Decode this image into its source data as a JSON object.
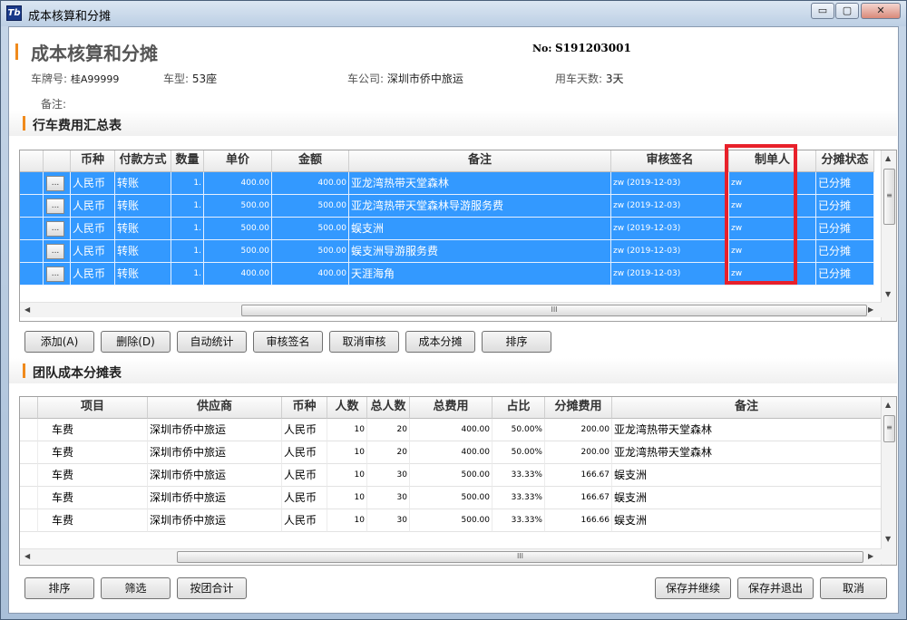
{
  "window": {
    "title": "成本核算和分摊",
    "icon_text": "Tb",
    "controls": {
      "minimize": "▭",
      "restore": "▢",
      "close": "✕"
    }
  },
  "header": {
    "title": "成本核算和分摊",
    "no_label": "No:",
    "no_value": "S191203001"
  },
  "info": {
    "plate_label": "车牌号:",
    "plate_value": "桂A99999",
    "model_label": "车型:",
    "model_value": "53座",
    "company_label": "车公司:",
    "company_value": "深圳市侨中旅运",
    "days_label": "用车天数:",
    "days_value": "3天",
    "remark_label": "备注:"
  },
  "section1": {
    "title": "行车费用汇总表"
  },
  "expense_table": {
    "headers": [
      "币种",
      "付款方式",
      "数量",
      "单价",
      "金额",
      "备注",
      "审核签名",
      "制单人",
      "分摊状态"
    ],
    "row_button": "...",
    "rows": [
      {
        "currency": "人民币",
        "pay": "转账",
        "qty": "1.",
        "price": "400.00",
        "amount": "400.00",
        "remark": "亚龙湾热带天堂森林",
        "audit": "zw (2019-12-03)",
        "maker": "zw",
        "status": "已分摊"
      },
      {
        "currency": "人民币",
        "pay": "转账",
        "qty": "1.",
        "price": "500.00",
        "amount": "500.00",
        "remark": "亚龙湾热带天堂森林导游服务费",
        "audit": "zw (2019-12-03)",
        "maker": "zw",
        "status": "已分摊"
      },
      {
        "currency": "人民币",
        "pay": "转账",
        "qty": "1.",
        "price": "500.00",
        "amount": "500.00",
        "remark": "蜈支洲",
        "audit": "zw (2019-12-03)",
        "maker": "zw",
        "status": "已分摊"
      },
      {
        "currency": "人民币",
        "pay": "转账",
        "qty": "1.",
        "price": "500.00",
        "amount": "500.00",
        "remark": "蜈支洲导游服务费",
        "audit": "zw (2019-12-03)",
        "maker": "zw",
        "status": "已分摊"
      },
      {
        "currency": "人民币",
        "pay": "转账",
        "qty": "1.",
        "price": "400.00",
        "amount": "400.00",
        "remark": "天涯海角",
        "audit": "zw (2019-12-03)",
        "maker": "zw",
        "status": "已分摊"
      }
    ]
  },
  "actions1": {
    "add": "添加(A)",
    "delete": "删除(D)",
    "auto_stat": "自动统计",
    "audit_sign": "审核签名",
    "cancel_audit": "取消审核",
    "cost_split": "成本分摊",
    "sort": "排序"
  },
  "section2": {
    "title": "团队成本分摊表"
  },
  "split_table": {
    "headers": [
      "项目",
      "供应商",
      "币种",
      "人数",
      "总人数",
      "总费用",
      "占比",
      "分摊费用",
      "备注"
    ],
    "rows": [
      {
        "item": "车费",
        "supplier": "深圳市侨中旅运",
        "currency": "人民币",
        "people": "10",
        "total_people": "20",
        "total_cost": "400.00",
        "ratio": "50.00%",
        "split": "200.00",
        "remark": "亚龙湾热带天堂森林"
      },
      {
        "item": "车费",
        "supplier": "深圳市侨中旅运",
        "currency": "人民币",
        "people": "10",
        "total_people": "20",
        "total_cost": "400.00",
        "ratio": "50.00%",
        "split": "200.00",
        "remark": "亚龙湾热带天堂森林"
      },
      {
        "item": "车费",
        "supplier": "深圳市侨中旅运",
        "currency": "人民币",
        "people": "10",
        "total_people": "30",
        "total_cost": "500.00",
        "ratio": "33.33%",
        "split": "166.67",
        "remark": "蜈支洲"
      },
      {
        "item": "车费",
        "supplier": "深圳市侨中旅运",
        "currency": "人民币",
        "people": "10",
        "total_people": "30",
        "total_cost": "500.00",
        "ratio": "33.33%",
        "split": "166.67",
        "remark": "蜈支洲"
      },
      {
        "item": "车费",
        "supplier": "深圳市侨中旅运",
        "currency": "人民币",
        "people": "10",
        "total_people": "30",
        "total_cost": "500.00",
        "ratio": "33.33%",
        "split": "166.66",
        "remark": "蜈支洲"
      }
    ]
  },
  "footer": {
    "sort": "排序",
    "filter": "筛选",
    "group_total": "按团合计",
    "save_continue": "保存并继续",
    "save_exit": "保存并退出",
    "cancel": "取消"
  },
  "scroll_glyphs": {
    "up": "▲",
    "down": "▼",
    "left": "◀",
    "right": "▶",
    "grip_v": "≡",
    "grip_h": "III"
  },
  "colors": {
    "selection": "#3399ff",
    "accent": "#f08a1c",
    "highlight_box": "#e8202a"
  }
}
